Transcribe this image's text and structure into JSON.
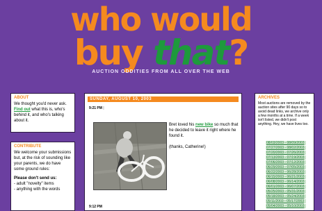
{
  "logo": {
    "line1": "who would",
    "line2_prefix": "buy ",
    "line2_highlight": "that",
    "line2_suffix": "?"
  },
  "tagline": "AUCTION ODDITIES FROM ALL OVER THE WEB",
  "about": {
    "title": "ABOUT",
    "text_before": "We thought you'd never ask. ",
    "link": "Find out",
    "text_after": " what this is, who's behind it, and who's talking about it."
  },
  "contribute": {
    "title": "CONTRIBUTE",
    "text": "We welcome your submissions but, at the risk of sounding like your parents, we do have some ground rules:",
    "subhead": "Please don't send us:",
    "item1": "- adult \"novelty\" items",
    "item2": "- anything with the words"
  },
  "post": {
    "date": "SUNDAY, AUGUST 10, 2003",
    "time": "9:21 PM",
    "sep": "|",
    "text_before": "Bret loved his ",
    "link": "new bike",
    "text_after": " so much that he decided to leave it right where he found it.",
    "thanks": "(thanks, Catherine!)",
    "time2": "9:12 PM"
  },
  "archives": {
    "title": "ARCHIVES",
    "text": "Most auctions are removed by the auction sites after 90 days so to avoid dead links, we archive only a few months at a time. If a week isn't listed, we didn't post anything. Hey, we have lives too.",
    "items": [
      "08/03/2003 - 08/09/2003",
      "07/27/2003 - 08/02/2003",
      "07/20/2003 - 07/26/2003",
      "07/13/2003 - 07/19/2003",
      "07/06/2003 - 07/12/2003",
      "06/29/2003 - 07/05/2003",
      "06/22/2003 - 06/28/2003",
      "06/15/2003 - 06/21/2003",
      "06/08/2003 - 06/14/2003",
      "06/01/2003 - 06/07/2003",
      "05/25/2003 - 05/31/2003",
      "05/18/2003 - 05/24/2003",
      "05/11/2003 - 05/17/2003",
      "05/04/2003 - 05/10/2003"
    ]
  }
}
